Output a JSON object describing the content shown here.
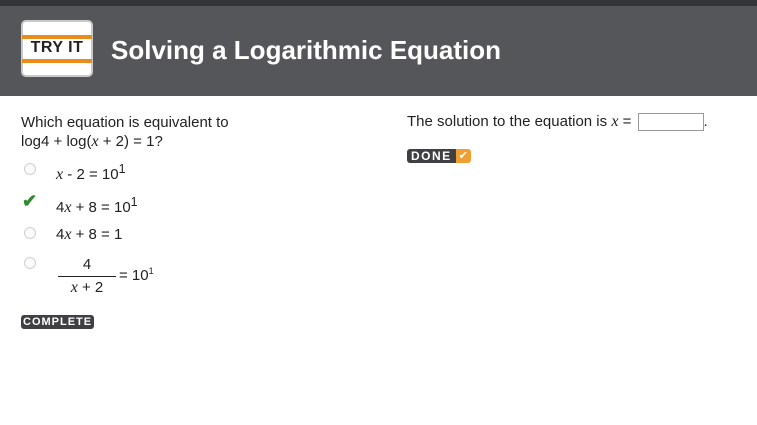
{
  "header": {
    "logo_text": "TRY IT",
    "title": "Solving a Logarithmic Equation"
  },
  "question": {
    "line1": "Which equation is equivalent to",
    "line2_pre": "log4 + log(",
    "line2_var": "x",
    "line2_post": " + 2) = 1?"
  },
  "options": [
    {
      "var": "x",
      "rest": " - 2 = 10",
      "sup": "1",
      "selected": false
    },
    {
      "coef": "4",
      "var": "x",
      "rest": " + 8 = 10",
      "sup": "1",
      "selected": true
    },
    {
      "coef": "4",
      "var": "x",
      "rest": " + 8 = 1",
      "selected": false
    },
    {
      "numerator": "4",
      "den_var": "x",
      "den_rest": " + 2",
      "rhs": "= 10",
      "sup": "1",
      "selected": false
    }
  ],
  "complete_badge": "COMPLETE",
  "solution": {
    "prefix": "The solution to the equation is ",
    "var": "x",
    "equals": " = ",
    "value": "",
    "suffix": "."
  },
  "done_button": "DONE",
  "colors": {
    "header_bg": "#55565a",
    "accent_orange": "#ea8b1a",
    "check_green": "#2e8b2e"
  },
  "icons": {
    "selected": "checkmark-icon",
    "done": "checkbox-check-icon"
  }
}
